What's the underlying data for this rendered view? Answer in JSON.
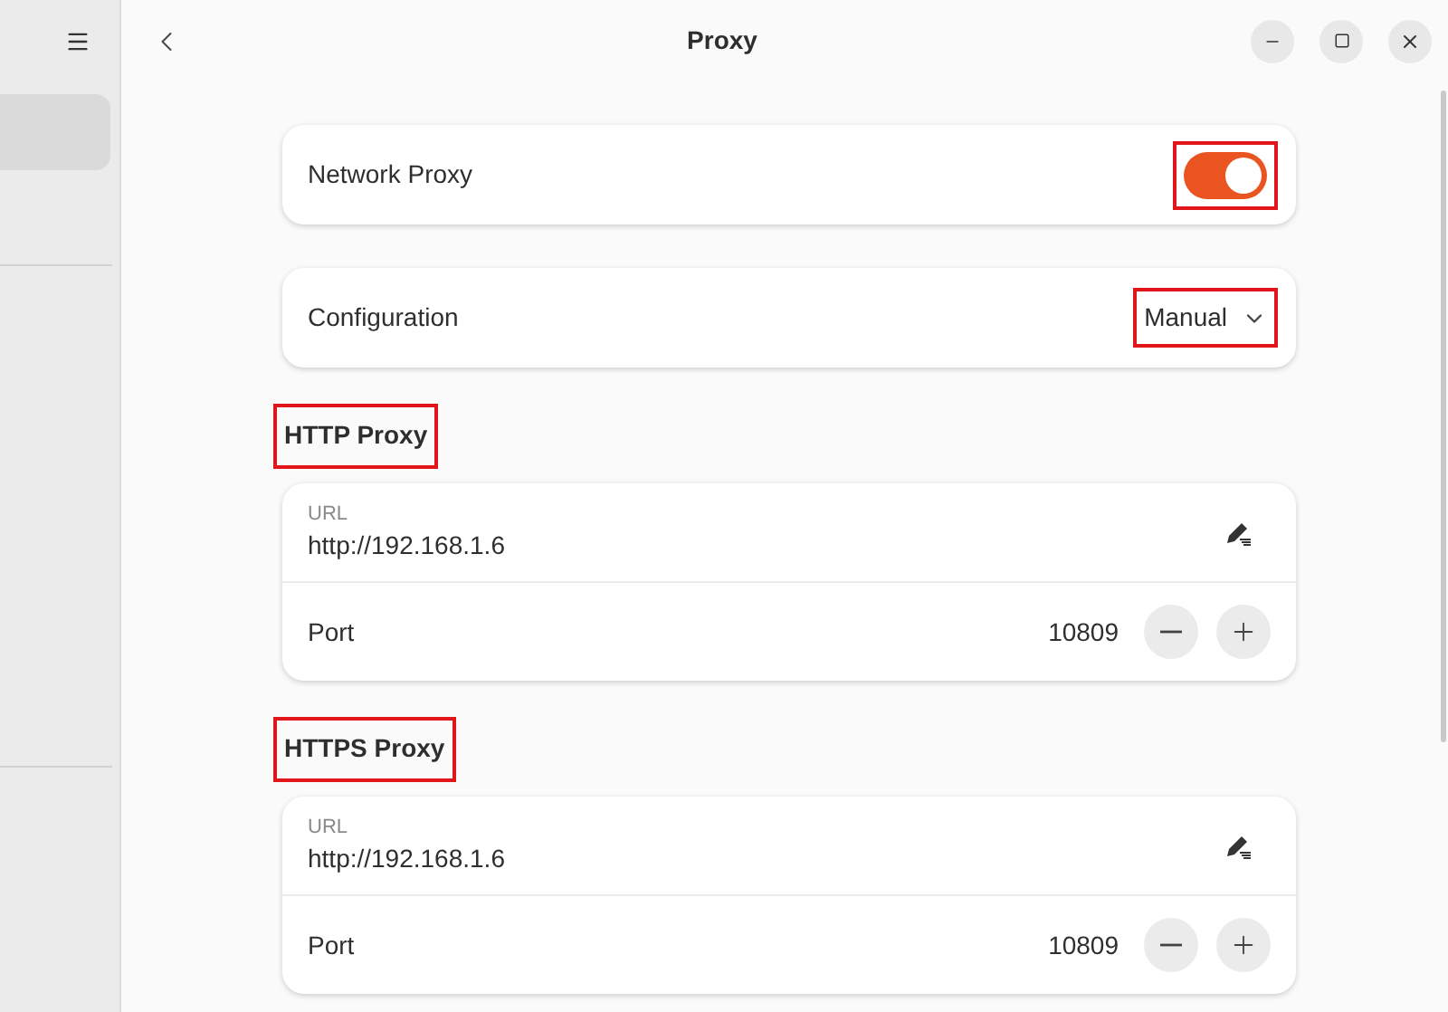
{
  "window": {
    "title": "Proxy"
  },
  "sidebar": {
    "items": [
      {
        "selected": true
      }
    ]
  },
  "network_proxy": {
    "label": "Network Proxy",
    "on": true,
    "highlighted": true
  },
  "configuration": {
    "label": "Configuration",
    "value": "Manual",
    "highlighted": true
  },
  "sections": [
    {
      "heading": "HTTP Proxy",
      "highlighted": true,
      "url_label": "URL",
      "url": "http://192.168.1.6",
      "port_label": "Port",
      "port": "10809"
    },
    {
      "heading": "HTTPS Proxy",
      "highlighted": true,
      "url_label": "URL",
      "url": "http://192.168.1.6",
      "port_label": "Port",
      "port": "10809"
    }
  ]
}
